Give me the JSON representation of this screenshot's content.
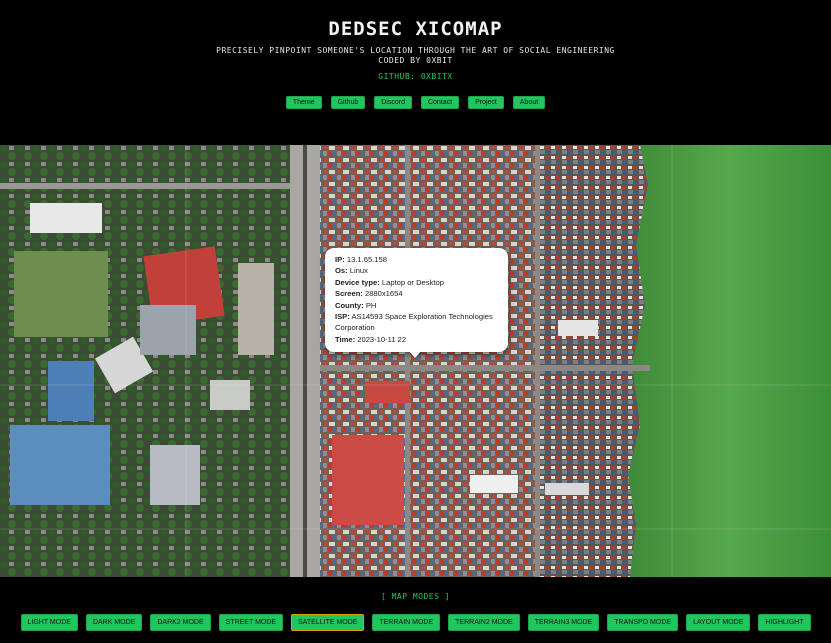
{
  "header": {
    "title": "DEDSEC XICOMAP",
    "subtitle_line1": "PRECISELY PINPOINT SOMEONE'S LOCATION THROUGH THE ART OF SOCIAL ENGINEERING",
    "subtitle_line2": "CODED BY 0XBIT",
    "github": "GITHUB: 0XBITX"
  },
  "nav": [
    "Theme",
    "Github",
    "Discord",
    "Contact",
    "Project",
    "About"
  ],
  "popup": {
    "ip_label": "IP:",
    "ip": "13.1.65.158",
    "os_label": "Os:",
    "os": "Linux",
    "device_label": "Device type:",
    "device": "Laptop or Desktop",
    "screen_label": "Screen:",
    "screen": "2880x1654",
    "county_label": "County:",
    "county": "PH",
    "isp_label": "ISP:",
    "isp": "AS14593 Space Exploration Technologies Corporation",
    "time_label": "Time:",
    "time": "2023-10-11 22"
  },
  "map_modes": {
    "title": "[ MAP MODES ]",
    "active": "SATELLITE MODE",
    "buttons": [
      "LIGHT MODE",
      "DARK MODE",
      "DARK2 MODE",
      "STREET MODE",
      "SATELLITE MODE",
      "TERRAIN MODE",
      "TERRAIN2 MODE",
      "TERRAIN3 MODE",
      "TRANSPO MODE",
      "LAYOUT MODE",
      "HIGHLIGHT"
    ]
  },
  "colors": {
    "accent": "#22c55e",
    "background": "#000000",
    "active_border": "#d1a20c"
  }
}
